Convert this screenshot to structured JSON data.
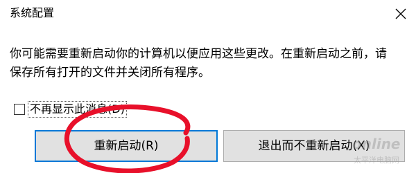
{
  "window": {
    "title": "系统配置",
    "close_icon": "close-icon"
  },
  "message": {
    "line1": "你可能需要重新启动你的计算机以便应用这些更改。在重新启动之前，请",
    "line2": "保存所有打开的文件并关闭所有程序。"
  },
  "checkbox": {
    "label": "不再显示此消息(D)",
    "checked": false
  },
  "buttons": {
    "restart_label": "重新启动(R)",
    "exit_label": "退出而不重新启动(X)"
  },
  "annotation": {
    "color": "#e8102a"
  },
  "watermark": {
    "text": "online",
    "sub": "太平洋电脑网"
  },
  "colors": {
    "focus_border": "#0078d7",
    "button_bg": "#e1e1e1",
    "button_border": "#adadad"
  }
}
